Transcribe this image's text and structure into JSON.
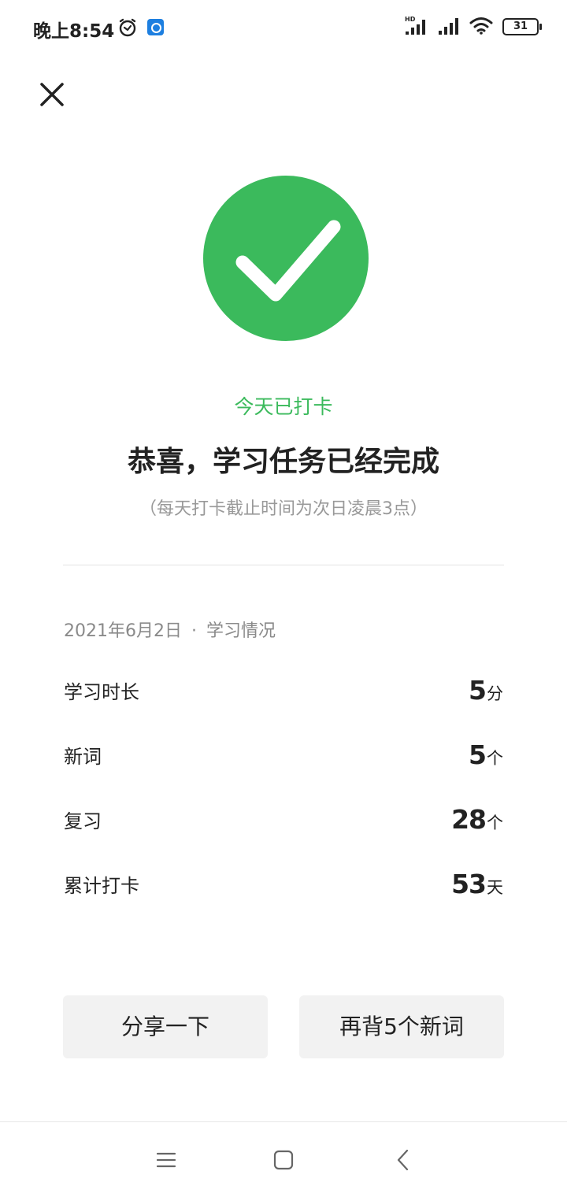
{
  "status_bar": {
    "time": "晚上8:54",
    "network_badge": "HD",
    "battery_level": "31",
    "icons": [
      "alarm-icon",
      "app-notification-icon",
      "signal-icon",
      "wifi-icon",
      "battery-icon"
    ]
  },
  "success": {
    "checkin_status": "今天已打卡",
    "headline": "恭喜，学习任务已经完成",
    "deadline_note": "（每天打卡截止时间为次日凌晨3点）",
    "icon": "check-icon"
  },
  "stats": {
    "date": "2021年6月2日",
    "separator": "·",
    "title": "学习情况",
    "rows": [
      {
        "label": "学习时长",
        "value": "5",
        "unit": "分"
      },
      {
        "label": "新词",
        "value": "5",
        "unit": "个"
      },
      {
        "label": "复习",
        "value": "28",
        "unit": "个"
      },
      {
        "label": "累计打卡",
        "value": "53",
        "unit": "天"
      }
    ]
  },
  "actions": {
    "share_label": "分享一下",
    "more_words_label": "再背5个新词"
  },
  "nav_bar": {
    "icons": [
      "menu-icon",
      "home-icon",
      "back-icon"
    ]
  },
  "colors": {
    "accent": "#3bba5c",
    "button_bg": "#f2f2f2",
    "muted_text": "#999999"
  }
}
